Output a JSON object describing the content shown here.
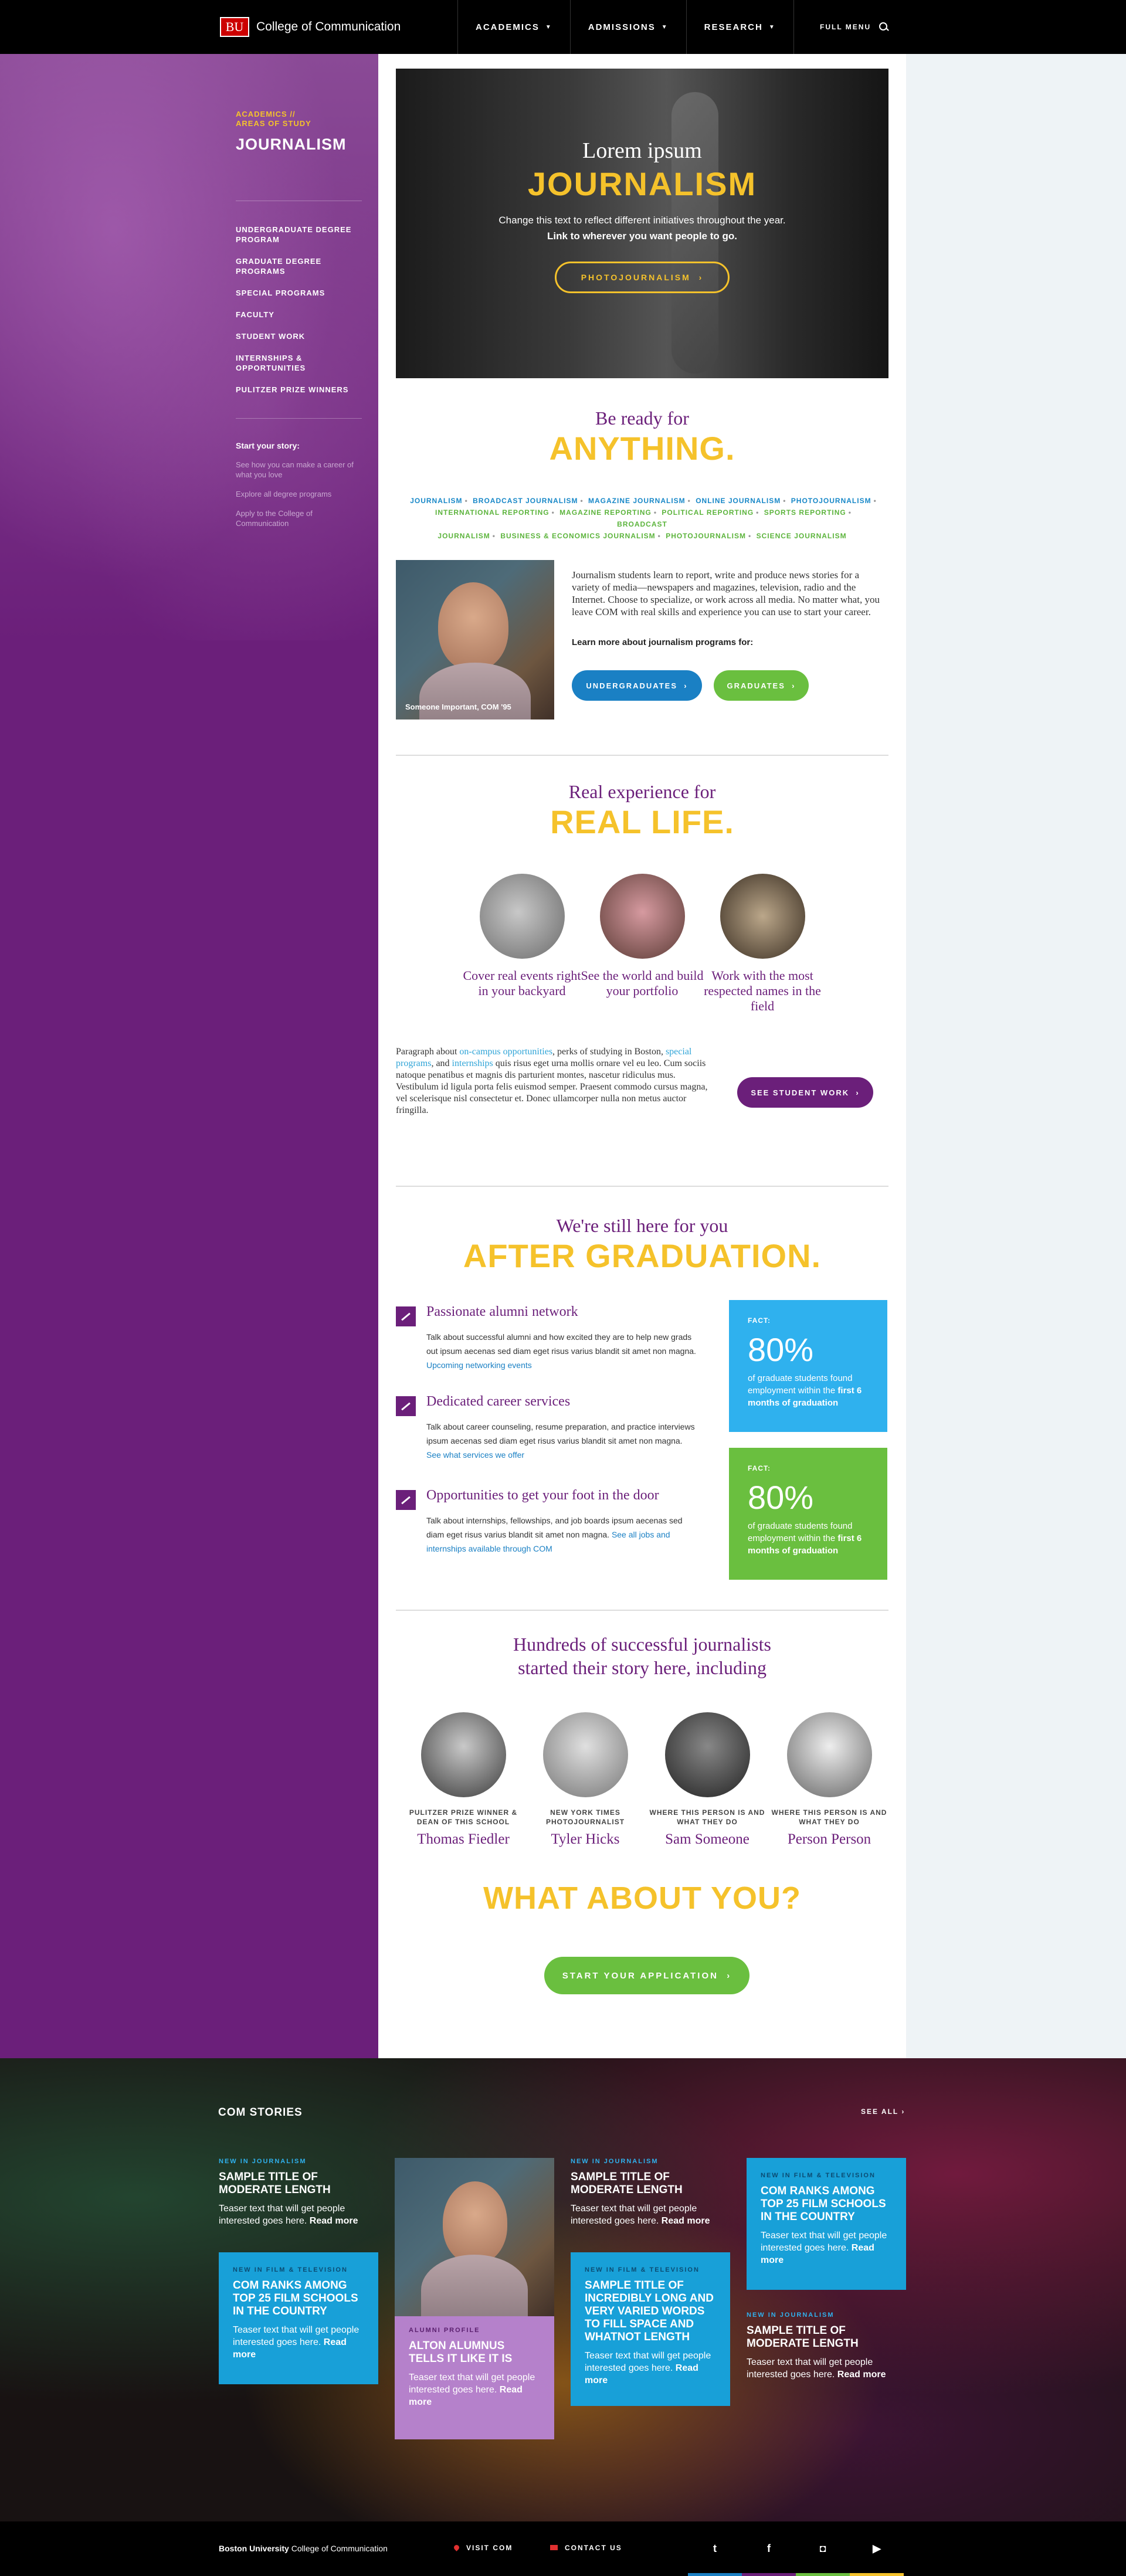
{
  "brand": {
    "logo": "BU",
    "name": "College of Communication"
  },
  "nav": {
    "items": [
      "ACADEMICS",
      "ADMISSIONS",
      "RESEARCH"
    ],
    "full_menu": "FULL MENU"
  },
  "sidebar": {
    "eyebrow": "ACADEMICS //\nAREAS OF STUDY",
    "title": "JOURNALISM",
    "menu": [
      "UNDERGRADUATE DEGREE PROGRAM",
      "GRADUATE DEGREE PROGRAMS",
      "SPECIAL PROGRAMS",
      "FACULTY",
      "STUDENT WORK",
      "INTERNSHIPS & OPPORTUNITIES",
      "PULITZER PRIZE WINNERS"
    ],
    "story_title": "Start your story:",
    "story_links": [
      "See how you can make a career of what you love",
      "Explore all degree programs",
      "Apply to the College of Communication"
    ]
  },
  "hero": {
    "pre": "Lorem ipsum",
    "title": "JOURNALISM",
    "desc": "Change this text to reflect different initiatives throughout the year.",
    "desc_bold": "Link to wherever you want people to go.",
    "button": "PHOTOJOURNALISM"
  },
  "ready": {
    "pre": "Be ready for",
    "title": "ANYTHING.",
    "tags_row1": [
      "JOURNALISM",
      "BROADCAST JOURNALISM",
      "MAGAZINE JOURNALISM",
      "ONLINE JOURNALISM",
      "PHOTOJOURNALISM"
    ],
    "tags_row2": [
      "INTERNATIONAL REPORTING",
      "MAGAZINE REPORTING",
      "POLITICAL REPORTING",
      "SPORTS REPORTING",
      "BROADCAST"
    ],
    "tags_row3": [
      "JOURNALISM",
      "BUSINESS & ECONOMICS JOURNALISM",
      "PHOTOJOURNALISM",
      "SCIENCE JOURNALISM"
    ]
  },
  "intro": {
    "caption": "Someone Important, COM '95",
    "text": "Journalism students learn to report, write and produce news stories for a variety of media—newspapers and magazines, television, radio and the Internet. Choose to specialize, or work across all media. No matter what, you leave COM with real skills and experience you can use to start your career.",
    "learn_more": "Learn more about journalism programs for:",
    "btn_under": "UNDERGRADUATES",
    "btn_grad": "GRADUATES"
  },
  "reallife": {
    "pre": "Real experience for",
    "title": "REAL LIFE.",
    "items": [
      "Cover real events right in your backyard",
      "See the world and build your portfolio",
      "Work with the most respected names in the field"
    ],
    "para_1": "Paragraph about ",
    "para_link1": "on-campus opportunities",
    "para_2": ", perks of studying in Boston, ",
    "para_link2": "special programs",
    "para_3": ", and ",
    "para_link3": "internships",
    "para_4": " quis risus eget urna mollis ornare vel eu leo. Cum sociis natoque penatibus et magnis dis parturient montes, nascetur ridiculus mus. Vestibulum id ligula porta felis euismod semper. Praesent commodo cursus magna, vel scelerisque nisl consectetur et. Donec ullamcorper nulla non metus auctor fringilla.",
    "button": "SEE STUDENT WORK"
  },
  "after": {
    "pre": "We're still here for you",
    "title": "AFTER GRADUATION.",
    "features": [
      {
        "title": "Passionate alumni network",
        "text": "Talk about successful alumni and how excited they are to help new grads out ipsum aecenas sed diam eget risus varius blandit sit amet non magna. ",
        "link": "Upcoming networking events"
      },
      {
        "title": "Dedicated career services",
        "text": "Talk about career counseling, resume preparation, and practice interviews ipsum aecenas sed diam eget risus varius blandit sit amet non magna. ",
        "link": "See what services we offer"
      },
      {
        "title": "Opportunities to get your foot in the door",
        "text": "Talk about internships, fellowships, and job boards ipsum aecenas sed diam eget risus varius blandit sit amet non magna. ",
        "link": "See all jobs and internships available through COM"
      }
    ],
    "facts": [
      {
        "label": "FACT:",
        "number": "80%",
        "text": "of graduate students found employment within the ",
        "bold": "first 6 months of graduation"
      },
      {
        "label": "FACT:",
        "number": "80%",
        "text": "of graduate students found employment within the ",
        "bold": "first 6 months of graduation"
      }
    ]
  },
  "hundreds": {
    "line1": "Hundreds of successful journalists",
    "line2": "started their story here, including",
    "alumni": [
      {
        "role": "PULITZER PRIZE WINNER & DEAN OF THIS SCHOOL",
        "name": "Thomas Fiedler"
      },
      {
        "role": "NEW YORK TIMES PHOTOJOURNALIST",
        "name": "Tyler Hicks"
      },
      {
        "role": "WHERE THIS PERSON IS AND WHAT THEY DO",
        "name": "Sam Someone"
      },
      {
        "role": "WHERE THIS PERSON IS AND WHAT THEY DO",
        "name": "Person Person"
      }
    ]
  },
  "cta": {
    "title": "WHAT ABOUT YOU?",
    "button": "START YOUR APPLICATION"
  },
  "stories": {
    "title": "COM STORIES",
    "see_all": "SEE ALL",
    "read_more": "Read more",
    "cards": [
      {
        "kicker": "NEW IN JOURNALISM",
        "title": "SAMPLE TITLE OF MODERATE LENGTH",
        "tease": "Teaser text that will get people interested goes here."
      },
      {
        "kicker": "NEW IN FILM & TELEVISION",
        "title": "COM RANKS AMONG TOP 25 FILM SCHOOLS IN THE COUNTRY",
        "tease": "Teaser text that will get people interested goes here."
      },
      {
        "kicker": "ALUMNI PROFILE",
        "title": "ALTON ALUMNUS TELLS IT LIKE IT IS",
        "tease": "Teaser text that will get people interested goes here."
      },
      {
        "kicker": "NEW IN JOURNALISM",
        "title": "SAMPLE TITLE OF MODERATE LENGTH",
        "tease": "Teaser text that will get people interested goes here."
      },
      {
        "kicker": "NEW IN FILM & TELEVISION",
        "title": "SAMPLE TITLE OF INCREDIBLY LONG AND VERY VARIED WORDS TO FILL SPACE AND WHATNOT LENGTH",
        "tease": "Teaser text that will get people interested goes here."
      },
      {
        "kicker": "NEW IN FILM & TELEVISION",
        "title": "COM RANKS AMONG TOP 25 FILM SCHOOLS IN THE COUNTRY",
        "tease": "Teaser text that will get people interested goes here."
      },
      {
        "kicker": "NEW IN JOURNALISM",
        "title": "SAMPLE TITLE OF MODERATE LENGTH",
        "tease": "Teaser text that will get people interested goes here."
      }
    ]
  },
  "footer": {
    "brand_bold": "Boston University",
    "brand_rest": " College of Communication",
    "visit": "VISIT COM",
    "contact": "CONTACT US",
    "social": [
      "twitter-icon",
      "facebook-icon",
      "instagram-icon",
      "youtube-icon"
    ]
  },
  "colors": {
    "purple": "#6b1f7a",
    "yellow": "#f5c22b",
    "blue": "#1a80c4",
    "green": "#6abf3f",
    "cyan": "#2fb1ee"
  }
}
